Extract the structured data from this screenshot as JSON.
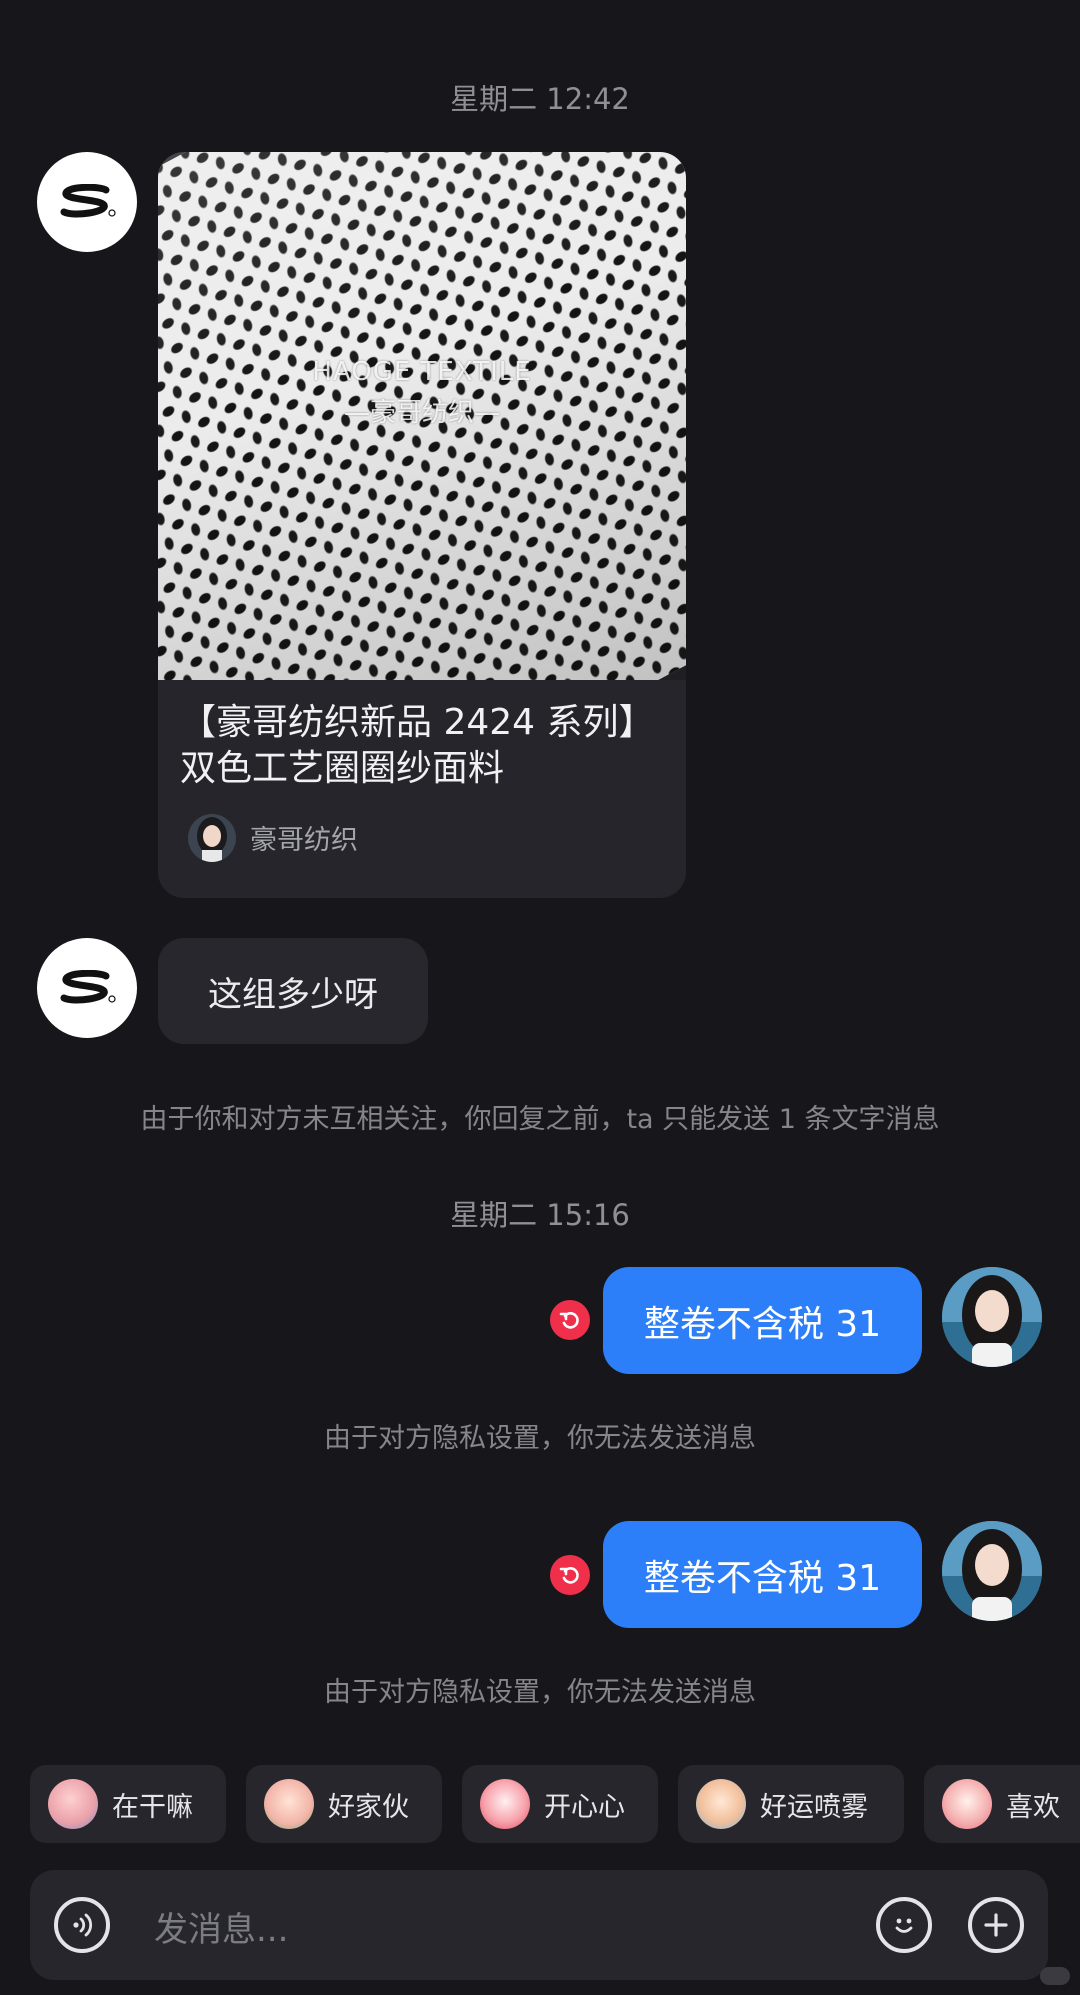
{
  "timestamps": [
    "星期二 12:42",
    "星期二 15:16"
  ],
  "card": {
    "watermark_en": "HAOGE TEXTILE",
    "watermark_cn": "—豪哥纺织—",
    "title": "【豪哥纺织新品 2424 系列】双色工艺圈圈纱面料",
    "author": "豪哥纺织"
  },
  "incoming_message": "这组多少呀",
  "notice_follow": "由于你和对方未互相关注，你回复之前，ta 只能发送 1 条文字消息",
  "outgoing": [
    {
      "text": "整卷不含税 31",
      "notice": "由于对方隐私设置，你无法发送消息"
    },
    {
      "text": "整卷不含税 31",
      "notice": "由于对方隐私设置，你无法发送消息"
    }
  ],
  "quick_replies": [
    "在干嘛",
    "好家伙",
    "开心心",
    "好运喷雾",
    "喜欢"
  ],
  "input": {
    "placeholder": "发消息..."
  },
  "icons": {
    "voice": "voice-icon",
    "emoji": "emoji-icon",
    "add": "plus-icon",
    "failed": "resend-icon",
    "contact_avatar": "s-logo-icon"
  },
  "colors": {
    "background": "#17171b",
    "outgoing_bubble": "#2d7ff9",
    "incoming_bubble": "#27272d",
    "failed": "#f0304a"
  }
}
